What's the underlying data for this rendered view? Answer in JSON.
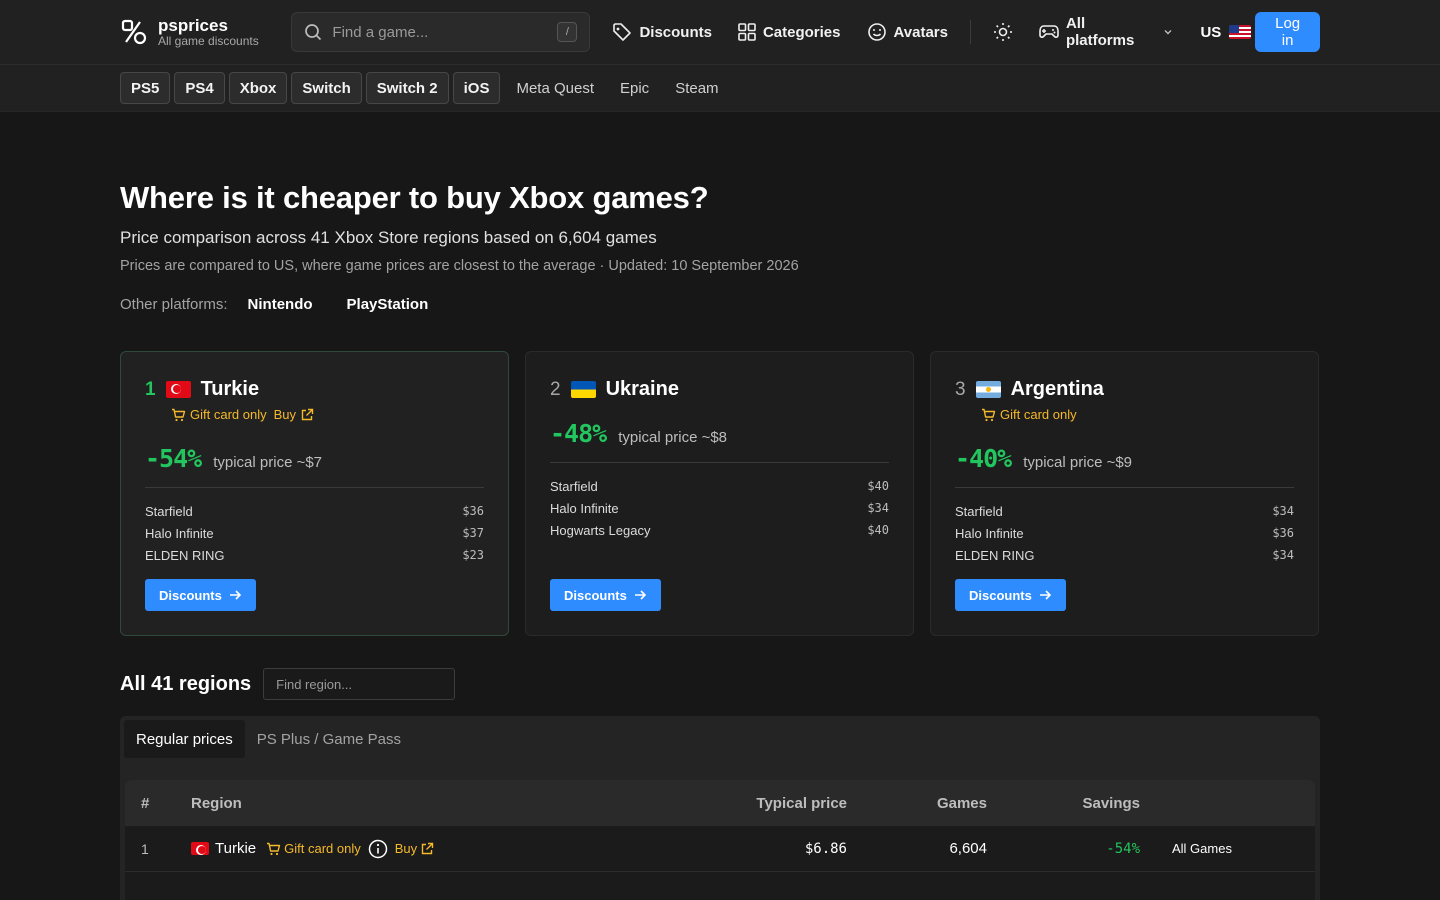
{
  "header": {
    "logo_name": "psprices",
    "logo_sub": "All game discounts",
    "search_placeholder": "Find a game...",
    "search_shortcut": "/",
    "nav": [
      {
        "label": "Discounts",
        "icon": "tag-icon"
      },
      {
        "label": "Categories",
        "icon": "grid-icon"
      },
      {
        "label": "Avatars",
        "icon": "smile-icon"
      }
    ],
    "platforms_label": "All platforms",
    "country": "US",
    "login_label": "Log in"
  },
  "platform_tabs": {
    "chips": [
      "PS5",
      "PS4",
      "Xbox",
      "Switch",
      "Switch 2",
      "iOS"
    ],
    "plain": [
      "Meta Quest",
      "Epic",
      "Steam"
    ]
  },
  "page": {
    "title": "Where is it cheaper to buy Xbox games?",
    "subtitle": "Price comparison across 41 Xbox Store regions based on 6,604 games",
    "note": "Prices are compared to US, where game prices are closest to the average · Updated: 10 September 2026",
    "other_label": "Other platforms:",
    "other_links": [
      "Nintendo",
      "PlayStation"
    ]
  },
  "top_cards": [
    {
      "rank": "1",
      "name": "Turkie",
      "gift": "Gift card only",
      "buy": "Buy",
      "pct": "-54%",
      "typical": "typical price ~$7",
      "games": [
        {
          "name": "Starfield",
          "price": "$36"
        },
        {
          "name": "Halo Infinite",
          "price": "$37"
        },
        {
          "name": "ELDEN RING",
          "price": "$23"
        }
      ],
      "button": "Discounts"
    },
    {
      "rank": "2",
      "name": "Ukraine",
      "pct": "-48%",
      "typical": "typical price ~$8",
      "games": [
        {
          "name": "Starfield",
          "price": "$40"
        },
        {
          "name": "Halo Infinite",
          "price": "$34"
        },
        {
          "name": "Hogwarts Legacy",
          "price": "$40"
        }
      ],
      "button": "Discounts"
    },
    {
      "rank": "3",
      "name": "Argentina",
      "gift": "Gift card only",
      "pct": "-40%",
      "typical": "typical price ~$9",
      "games": [
        {
          "name": "Starfield",
          "price": "$34"
        },
        {
          "name": "Halo Infinite",
          "price": "$36"
        },
        {
          "name": "ELDEN RING",
          "price": "$34"
        }
      ],
      "button": "Discounts"
    }
  ],
  "regions": {
    "title": "All 41 regions",
    "search_placeholder": "Find region...",
    "tabs": [
      "Regular prices",
      "PS Plus / Game Pass"
    ],
    "columns": [
      "#",
      "Region",
      "Typical price",
      "Games",
      "Savings"
    ],
    "rows": [
      {
        "num": "1",
        "region": "Turkie",
        "gift": "Gift card only",
        "buy": "Buy",
        "typical": "$6.86",
        "games": "6,604",
        "savings": "-54%",
        "link": "All Games"
      }
    ]
  },
  "colors": {
    "accent": "#2f8cff",
    "green": "#22c55e",
    "gift": "#f5b92a"
  }
}
